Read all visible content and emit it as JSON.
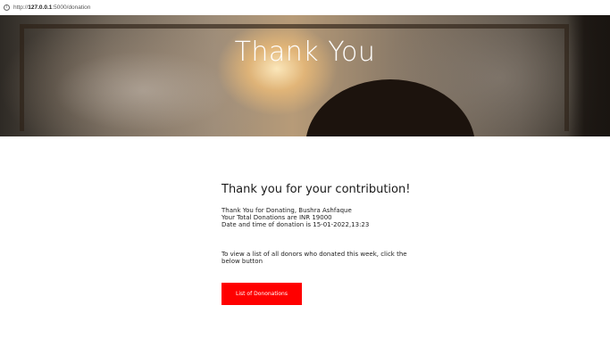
{
  "browser": {
    "url_scheme": "http://",
    "url_host": "127.0.0.1",
    "url_path": ":5000/donation"
  },
  "hero": {
    "title": "Thank You"
  },
  "main": {
    "heading": "Thank you for your contribution!",
    "donor_line": "Thank You for Donating, Bushra Ashfaque",
    "total_line": "Your Total Donations are INR 19000",
    "date_line": "Date and time of donation is 15-01-2022,13:23",
    "instruction": "To view a list of all donors who donated this week, click the below button",
    "button_label": "List of Dononations"
  },
  "colors": {
    "button_bg": "#ff0000",
    "button_text": "#ffffff",
    "hero_title": "#ffffff"
  }
}
